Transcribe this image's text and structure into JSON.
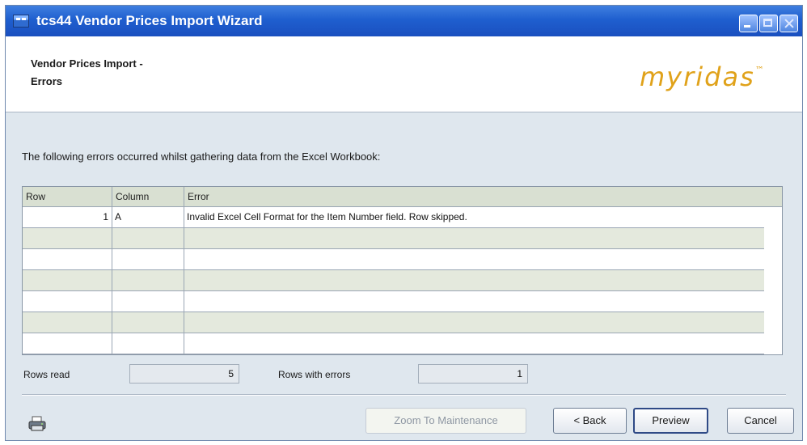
{
  "window": {
    "title": "tcs44 Vendor Prices Import Wizard"
  },
  "header": {
    "title": "Vendor Prices Import -\nErrors",
    "logo_text": "myridas",
    "logo_mark": "™"
  },
  "main": {
    "instructions": "The following errors occurred whilst gathering data from the Excel Workbook:"
  },
  "grid": {
    "columns": [
      "Row",
      "Column",
      "Error"
    ],
    "rows": [
      {
        "row": "1",
        "column": "A",
        "error": "Invalid Excel Cell Format for the Item Number field. Row skipped."
      },
      {
        "row": "",
        "column": "",
        "error": ""
      },
      {
        "row": "",
        "column": "",
        "error": ""
      },
      {
        "row": "",
        "column": "",
        "error": ""
      },
      {
        "row": "",
        "column": "",
        "error": ""
      },
      {
        "row": "",
        "column": "",
        "error": ""
      },
      {
        "row": "",
        "column": "",
        "error": ""
      }
    ]
  },
  "stats": {
    "rows_read_label": "Rows read",
    "rows_read_value": "5",
    "rows_errors_label": "Rows with errors",
    "rows_errors_value": "1"
  },
  "footer": {
    "zoom_label": "Zoom To Maintenance",
    "back_label": "< Back",
    "preview_label": "Preview",
    "cancel_label": "Cancel"
  },
  "icons": {
    "app": "app-window-icon",
    "printer": "printer-icon"
  },
  "colors": {
    "titlebar": "#1f5fcf",
    "logo": "#e0a21a",
    "grid_alt_row": "#e4e9dd",
    "grid_header": "#d9e0d2"
  }
}
